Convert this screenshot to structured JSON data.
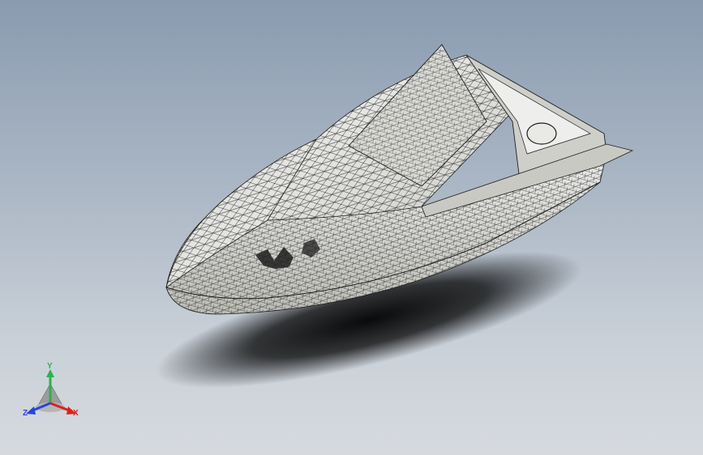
{
  "viewport": {
    "background_top": "#8a9bb0",
    "background_bottom": "#d6dadf",
    "model": {
      "type": "boat-hull",
      "display_style": "shaded-with-mesh-edges",
      "fill": "#d9d9d4",
      "mesh": "#1c1c1c"
    }
  },
  "triad": {
    "x_label": "X",
    "y_label": "Y",
    "z_label": "Z",
    "x_color": "#d8221c",
    "y_color": "#2bb24c",
    "z_color": "#2a44d8"
  }
}
